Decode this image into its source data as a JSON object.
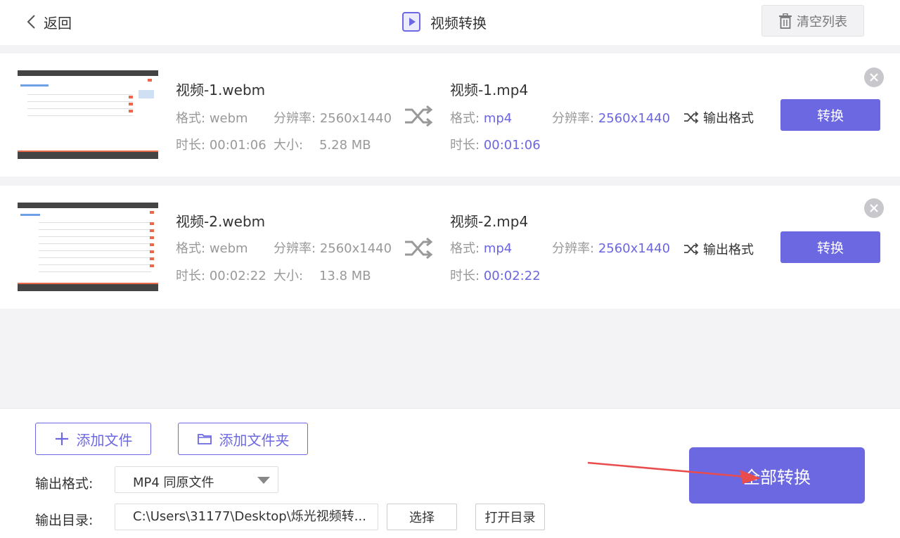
{
  "header": {
    "back_label": "返回",
    "title": "视频转换",
    "clear_label": "清空列表"
  },
  "files": [
    {
      "source_name": "视频-1.webm",
      "format_label": "格式:",
      "format": "webm",
      "resolution_label": "分辨率:",
      "resolution": "2560x1440",
      "duration_label": "时长:",
      "duration": "00:01:06",
      "size_label": "大小:",
      "size": "5.28 MB",
      "output_name": "视频-1.mp4",
      "output_format": "mp4",
      "output_resolution": "2560x1440",
      "output_duration": "00:01:06",
      "output_format_button": "输出格式",
      "convert_label": "转换"
    },
    {
      "source_name": "视频-2.webm",
      "format_label": "格式:",
      "format": "webm",
      "resolution_label": "分辨率:",
      "resolution": "2560x1440",
      "duration_label": "时长:",
      "duration": "00:02:22",
      "size_label": "大小:",
      "size": "13.8 MB",
      "output_name": "视频-2.mp4",
      "output_format": "mp4",
      "output_resolution": "2560x1440",
      "output_duration": "00:02:22",
      "output_format_button": "输出格式",
      "convert_label": "转换"
    }
  ],
  "bottom": {
    "add_file_label": "添加文件",
    "add_folder_label": "添加文件夹",
    "output_format_label": "输出格式:",
    "output_format_value": "MP4 同原文件",
    "output_dir_label": "输出目录:",
    "output_dir_value": "C:\\Users\\31177\\Desktop\\烁光视频转...",
    "choose_label": "选择",
    "open_dir_label": "打开目录",
    "convert_all_label": "全部转换"
  },
  "colors": {
    "accent": "#6c68e1",
    "highlight_text": "#6b66e0",
    "annotation_arrow": "#e84c4c"
  }
}
